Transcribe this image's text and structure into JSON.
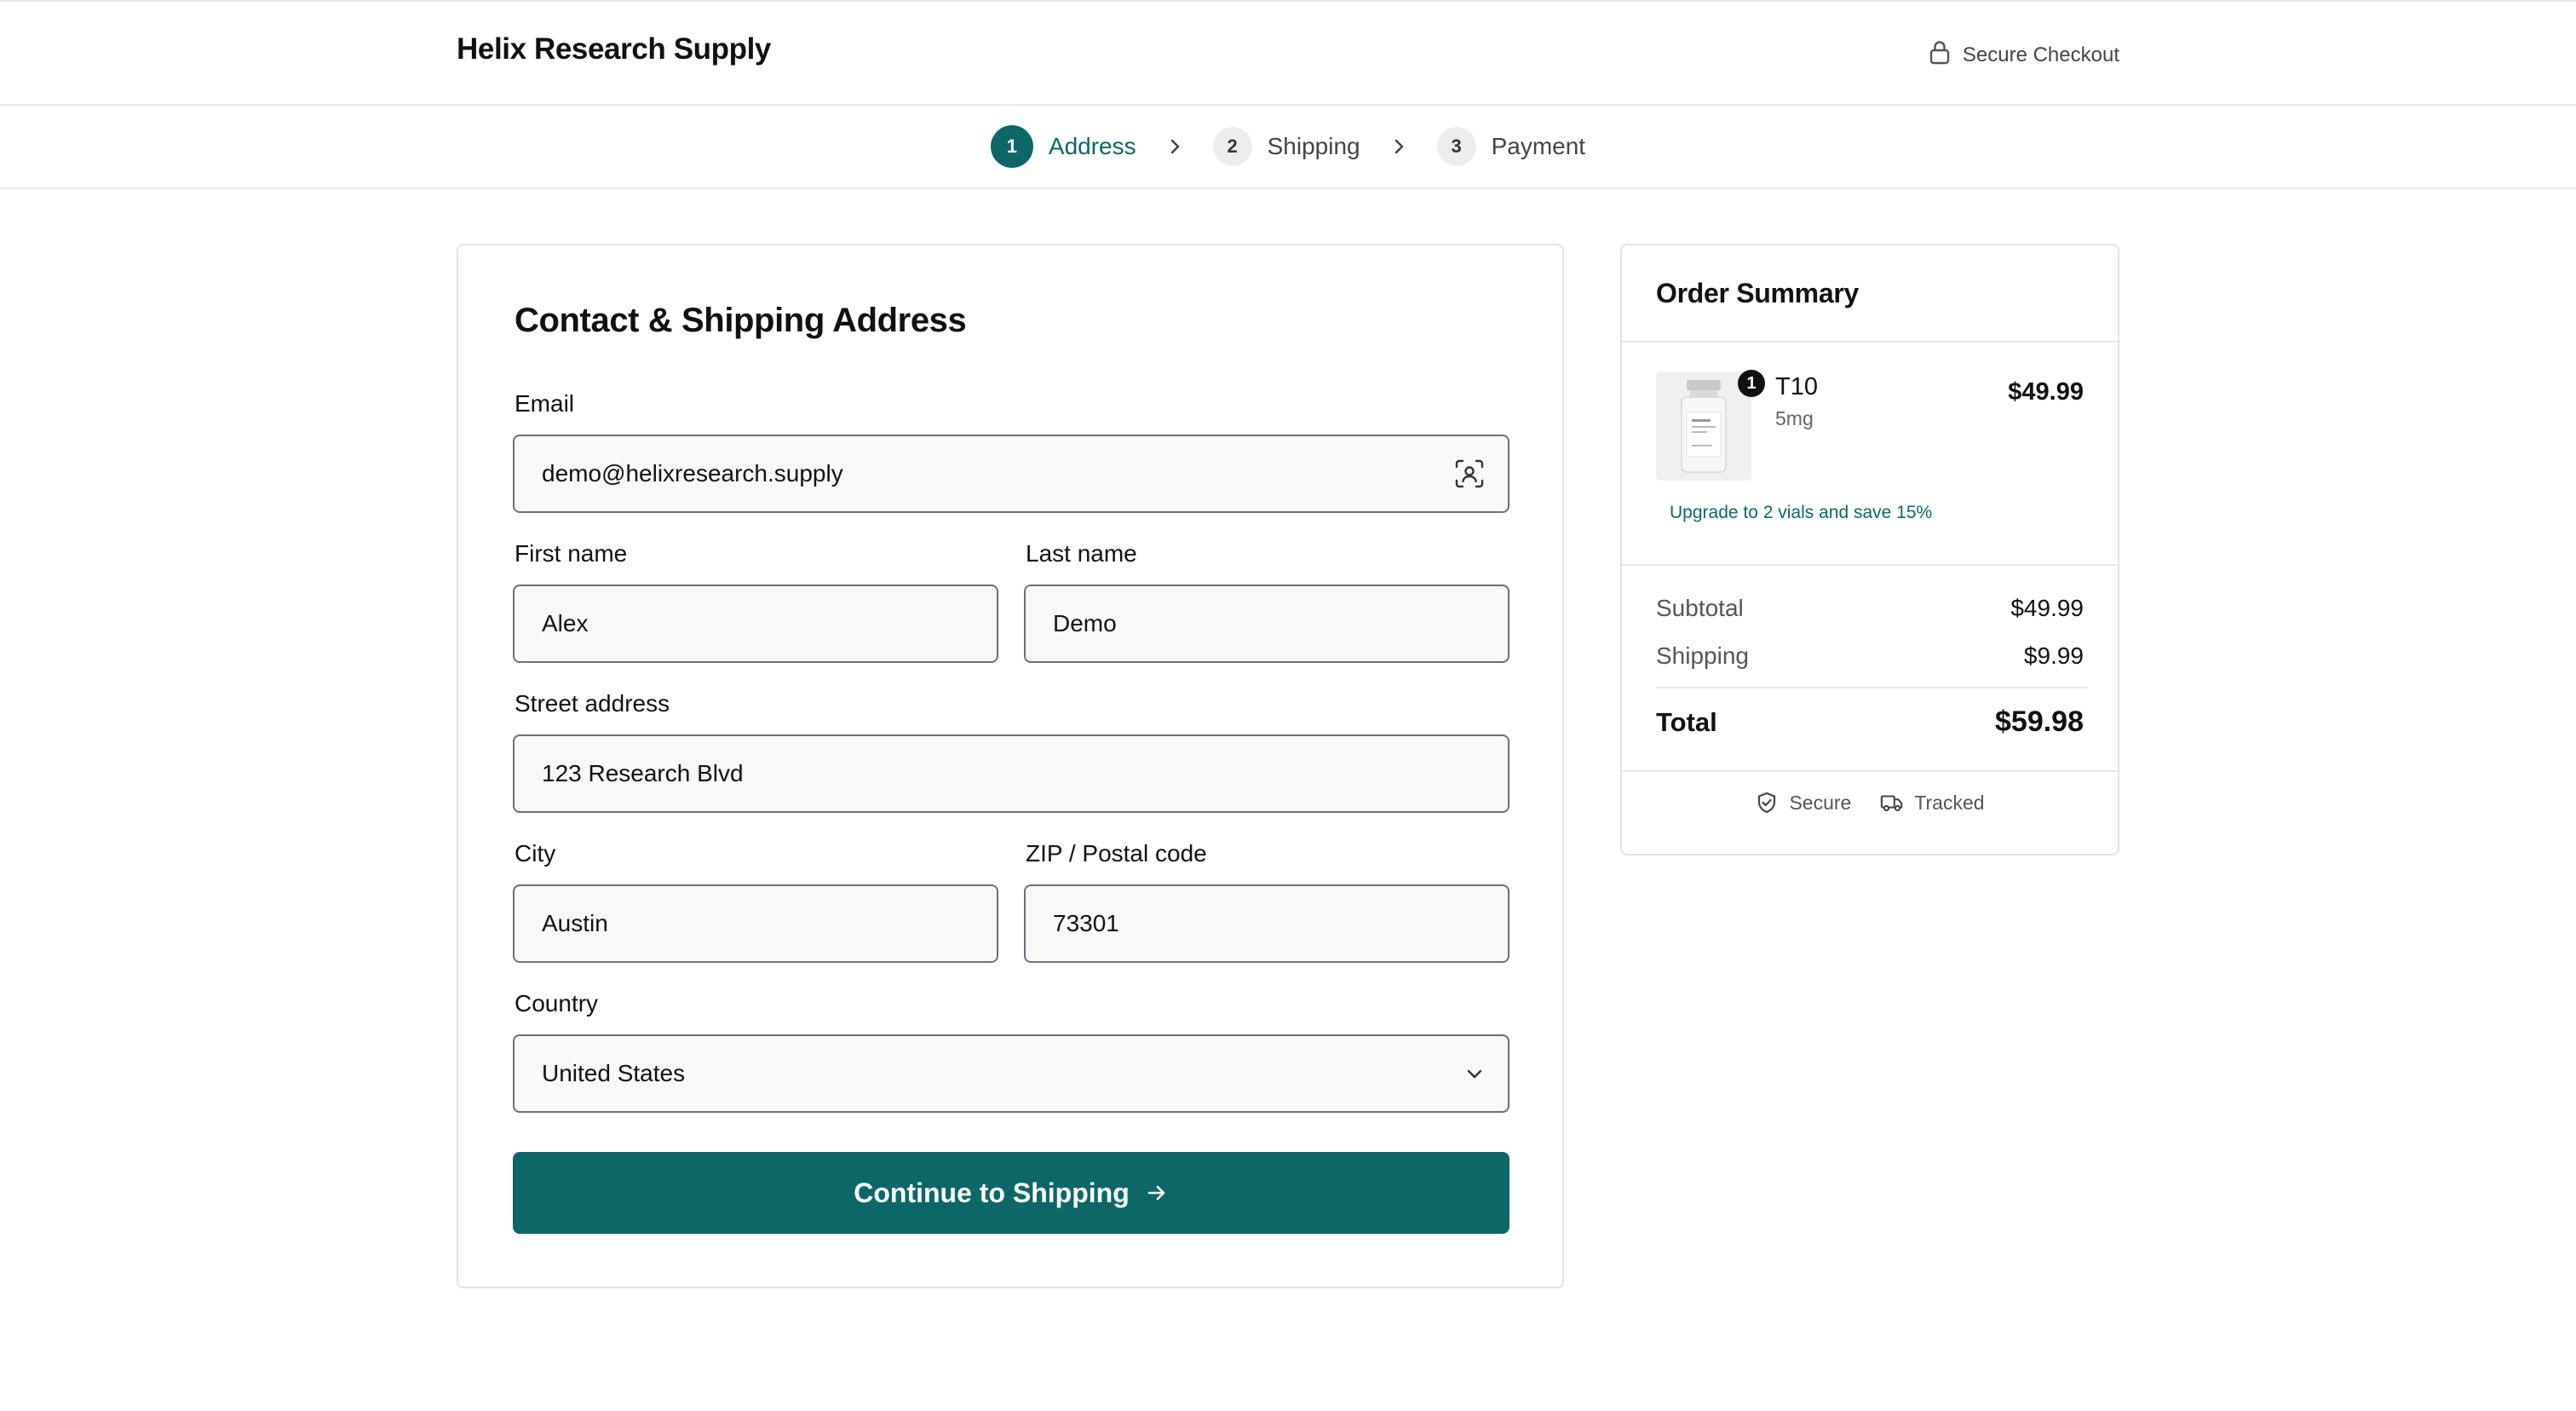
{
  "header": {
    "brand": "Helix Research Supply",
    "secure_label": "Secure Checkout"
  },
  "steps": [
    {
      "num": "1",
      "label": "Address",
      "active": true
    },
    {
      "num": "2",
      "label": "Shipping",
      "active": false
    },
    {
      "num": "3",
      "label": "Payment",
      "active": false
    }
  ],
  "form": {
    "title": "Contact & Shipping Address",
    "email_label": "Email",
    "email_value": "demo@helixresearch.supply",
    "first_name_label": "First name",
    "first_name_value": "Alex",
    "last_name_label": "Last name",
    "last_name_value": "Demo",
    "street_label": "Street address",
    "street_value": "123 Research Blvd",
    "city_label": "City",
    "city_value": "Austin",
    "zip_label": "ZIP / Postal code",
    "zip_value": "73301",
    "country_label": "Country",
    "country_value": "United States",
    "submit_label": "Continue to Shipping"
  },
  "summary": {
    "title": "Order Summary",
    "item": {
      "quantity": "1",
      "name": "T10",
      "variant": "5mg",
      "price": "$49.99"
    },
    "upsell": "Upgrade to 2 vials and save 15%",
    "subtotal_label": "Subtotal",
    "subtotal_value": "$49.99",
    "shipping_label": "Shipping",
    "shipping_value": "$9.99",
    "total_label": "Total",
    "total_value": "$59.98",
    "badges": {
      "secure": "Secure",
      "tracked": "Tracked"
    }
  },
  "colors": {
    "accent": "#0d6769",
    "border": "#e3e3e3",
    "input_border": "#6e6e78"
  },
  "icons": [
    "lock-icon",
    "chevron-right-icon",
    "contact-card-icon",
    "chevron-down-icon",
    "arrow-right-icon",
    "shield-check-icon",
    "truck-icon"
  ]
}
